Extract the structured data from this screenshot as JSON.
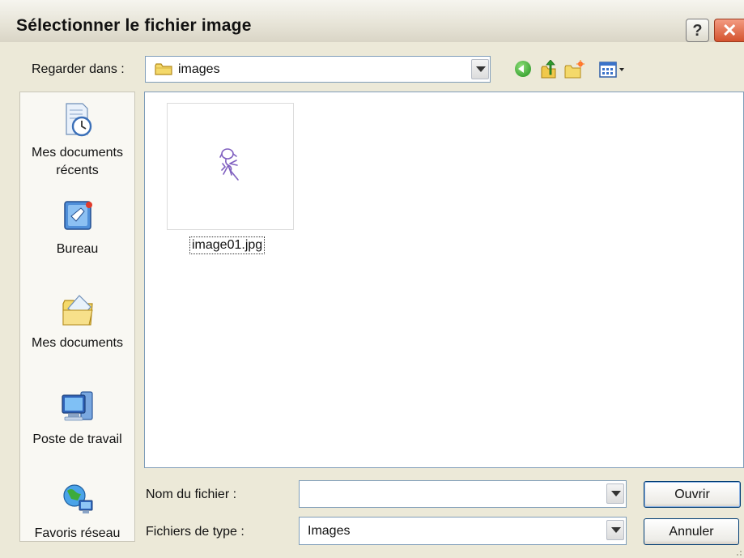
{
  "window": {
    "title": "Sélectionner le fichier image",
    "help_glyph": "?",
    "close_glyph": "✕"
  },
  "lookin": {
    "label": "Regarder dans :",
    "value": "images"
  },
  "toolbar": {
    "icons": [
      "back-icon",
      "up-folder-icon",
      "new-folder-icon",
      "views-menu-icon"
    ]
  },
  "places": [
    {
      "label": "Mes documents récents",
      "icon": "recent-documents-icon"
    },
    {
      "label": "Bureau",
      "icon": "desktop-icon"
    },
    {
      "label": "Mes documents",
      "icon": "my-documents-icon"
    },
    {
      "label": "Poste de travail",
      "icon": "my-computer-icon"
    },
    {
      "label": "Favoris réseau",
      "icon": "network-places-icon"
    }
  ],
  "files": [
    {
      "name": "image01.jpg",
      "selected": true
    }
  ],
  "filename": {
    "label": "Nom du fichier :",
    "value": ""
  },
  "filetype": {
    "label": "Fichiers de type :",
    "value": "Images"
  },
  "buttons": {
    "open": "Ouvrir",
    "cancel": "Annuler"
  },
  "colors": {
    "accent_border": "#7f9db9",
    "close_red": "#d4532e",
    "button_border": "#003c74"
  }
}
